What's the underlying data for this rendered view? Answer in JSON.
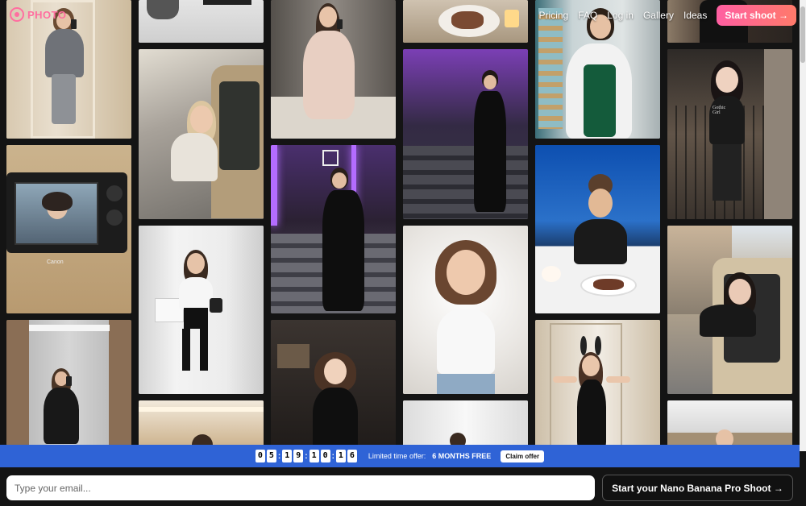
{
  "header": {
    "logo_text": "PHOTO",
    "nav": [
      {
        "label": "Pricing"
      },
      {
        "label": "FAQ"
      },
      {
        "label": "Log in"
      },
      {
        "label": "Gallery"
      },
      {
        "label": "Ideas"
      }
    ],
    "start_button": "Start shoot →"
  },
  "gallery": {
    "camera_brand": "Canon",
    "shirt_text": "Gothic Girl"
  },
  "offer": {
    "countdown_digits": [
      "0",
      "5",
      "1",
      "9",
      "1",
      "0",
      "1",
      "6"
    ],
    "label": "Limited time offer:",
    "highlight": "6 MONTHS FREE",
    "claim_label": "Claim offer"
  },
  "footer": {
    "email_placeholder": "Type your email...",
    "cta_label": "Start your Nano Banana Pro Shoot →"
  },
  "colors": {
    "brand_pink": "#ff6fa0",
    "offer_blue": "#2f63d6",
    "background": "#141414"
  }
}
